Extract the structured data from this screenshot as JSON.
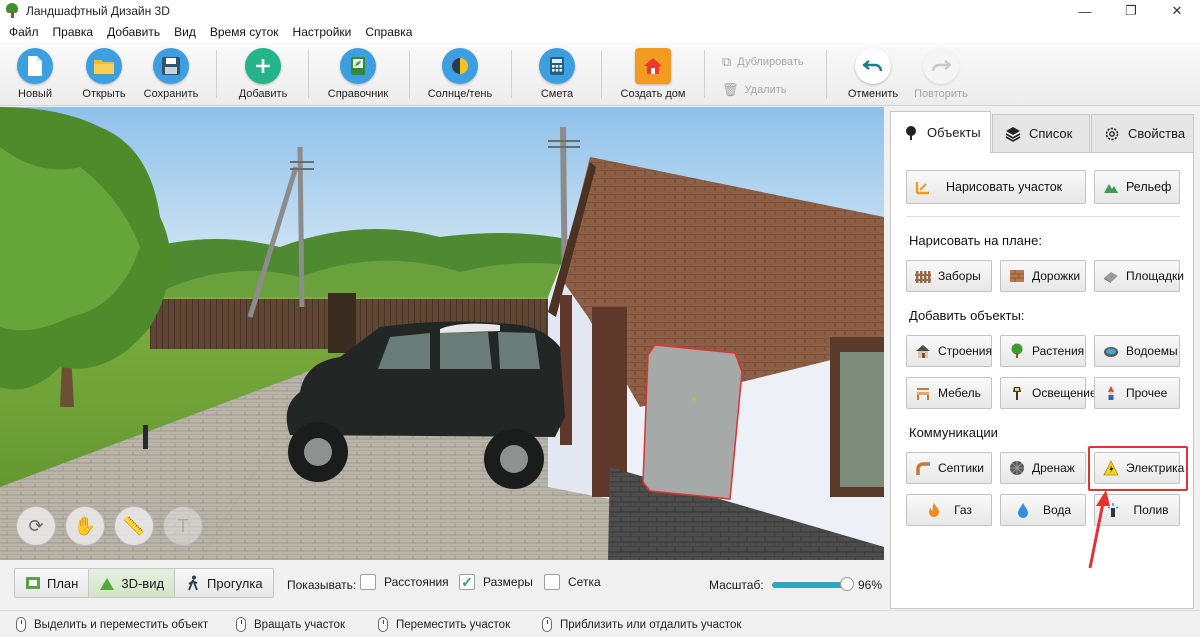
{
  "window": {
    "title": "Ландшафтный Дизайн 3D",
    "minimize": "—",
    "maximize": "❐",
    "close": "✕"
  },
  "menu": [
    "Файл",
    "Правка",
    "Добавить",
    "Вид",
    "Время суток",
    "Настройки",
    "Справка"
  ],
  "toolbar": {
    "new": "Новый",
    "open": "Открыть",
    "save": "Сохранить",
    "add": "Добавить",
    "reference": "Справочник",
    "sun_shadow": "Солнце/тень",
    "estimate": "Смета",
    "create_house": "Создать дом",
    "duplicate": "Дублировать",
    "delete": "Удалить",
    "undo": "Отменить",
    "redo": "Повторить"
  },
  "view_modes": {
    "plan": "План",
    "view3d": "3D-вид",
    "walk": "Прогулка",
    "active": "3D-вид"
  },
  "show": {
    "label": "Показывать:",
    "distances": "Расстояния",
    "sizes": "Размеры",
    "grid": "Сетка",
    "distances_checked": false,
    "sizes_checked": true,
    "grid_checked": false
  },
  "scale": {
    "label": "Масштаб:",
    "value_text": "96%",
    "fraction": 0.96
  },
  "view_tools": {
    "text_tool": "T"
  },
  "status_hints": {
    "select": "Выделить и переместить объект",
    "rotate": "Вращать участок",
    "move": "Переместить участок",
    "zoom": "Приблизить или отдалить участок"
  },
  "panel": {
    "tabs": {
      "objects": "Объекты",
      "list": "Список",
      "properties": "Свойства",
      "active": "Объекты"
    },
    "draw_plot": "Нарисовать участок",
    "relief": "Рельеф",
    "draw_on_plan_title": "Нарисовать на плане:",
    "fences": "Заборы",
    "paths": "Дорожки",
    "areas": "Площадки",
    "add_objects_title": "Добавить объекты:",
    "buildings": "Строения",
    "plants": "Растения",
    "ponds": "Водоемы",
    "furniture": "Мебель",
    "lighting": "Освещение",
    "other": "Прочее",
    "communications_title": "Коммуникации",
    "septic": "Септики",
    "drainage": "Дренаж",
    "electric": "Электрика",
    "gas": "Газ",
    "water": "Вода",
    "irrigation": "Полив"
  },
  "colors": {
    "accent": "#2ba7c4",
    "highlight": "#e23232"
  }
}
